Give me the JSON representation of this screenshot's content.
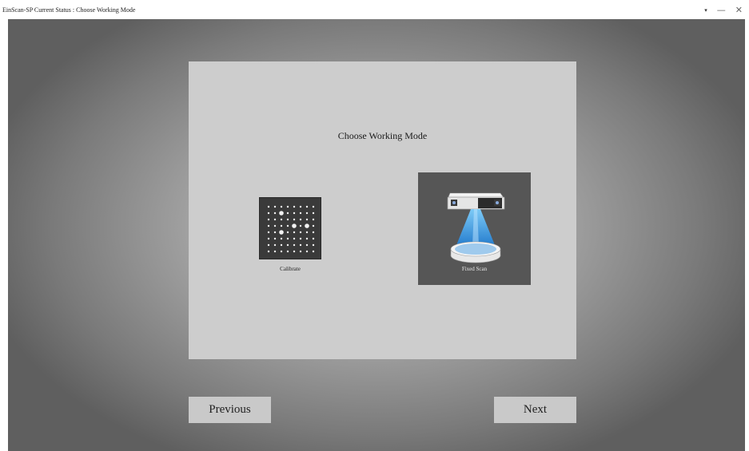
{
  "window": {
    "title": "EinScan-SP Current Status : Choose Working Mode",
    "controls": {
      "dropdown": "▾",
      "minimize": "—",
      "close": "✕"
    }
  },
  "panel": {
    "title": "Choose Working Mode",
    "modes": [
      {
        "label": "Calibrate",
        "icon": "calibration-board-icon"
      },
      {
        "label": "Fixed Scan",
        "icon": "fixed-scan-scanner-icon",
        "selected": true
      }
    ]
  },
  "navigation": {
    "previous": "Previous",
    "next": "Next"
  }
}
